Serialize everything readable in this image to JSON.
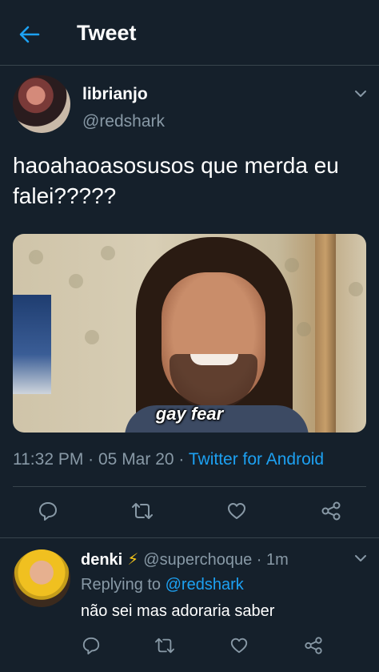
{
  "header": {
    "title": "Tweet",
    "back_icon": "arrow-left-icon"
  },
  "tweet": {
    "author_name": "librianjo",
    "author_handle": "@redshark",
    "text": "haoahaoasosusos que merda eu falei?????",
    "media_caption": "gay fear",
    "time": "11:32 PM",
    "date": "05 Mar 20",
    "source": "Twitter for Android",
    "separator": " · "
  },
  "reply": {
    "author_name": "denki",
    "badge": "⚡",
    "author_handle": "@superchoque",
    "age": "1m",
    "replying_prefix": "Replying to",
    "replying_to": "@redshark",
    "text": "não sei mas adoraria saber"
  },
  "icons": [
    "reply-icon",
    "retweet-icon",
    "like-icon",
    "share-icon",
    "chevron-down-icon"
  ],
  "colors": {
    "background": "#15202b",
    "accent": "#1da1f2",
    "muted": "#8899a6",
    "divider": "#38444d"
  }
}
